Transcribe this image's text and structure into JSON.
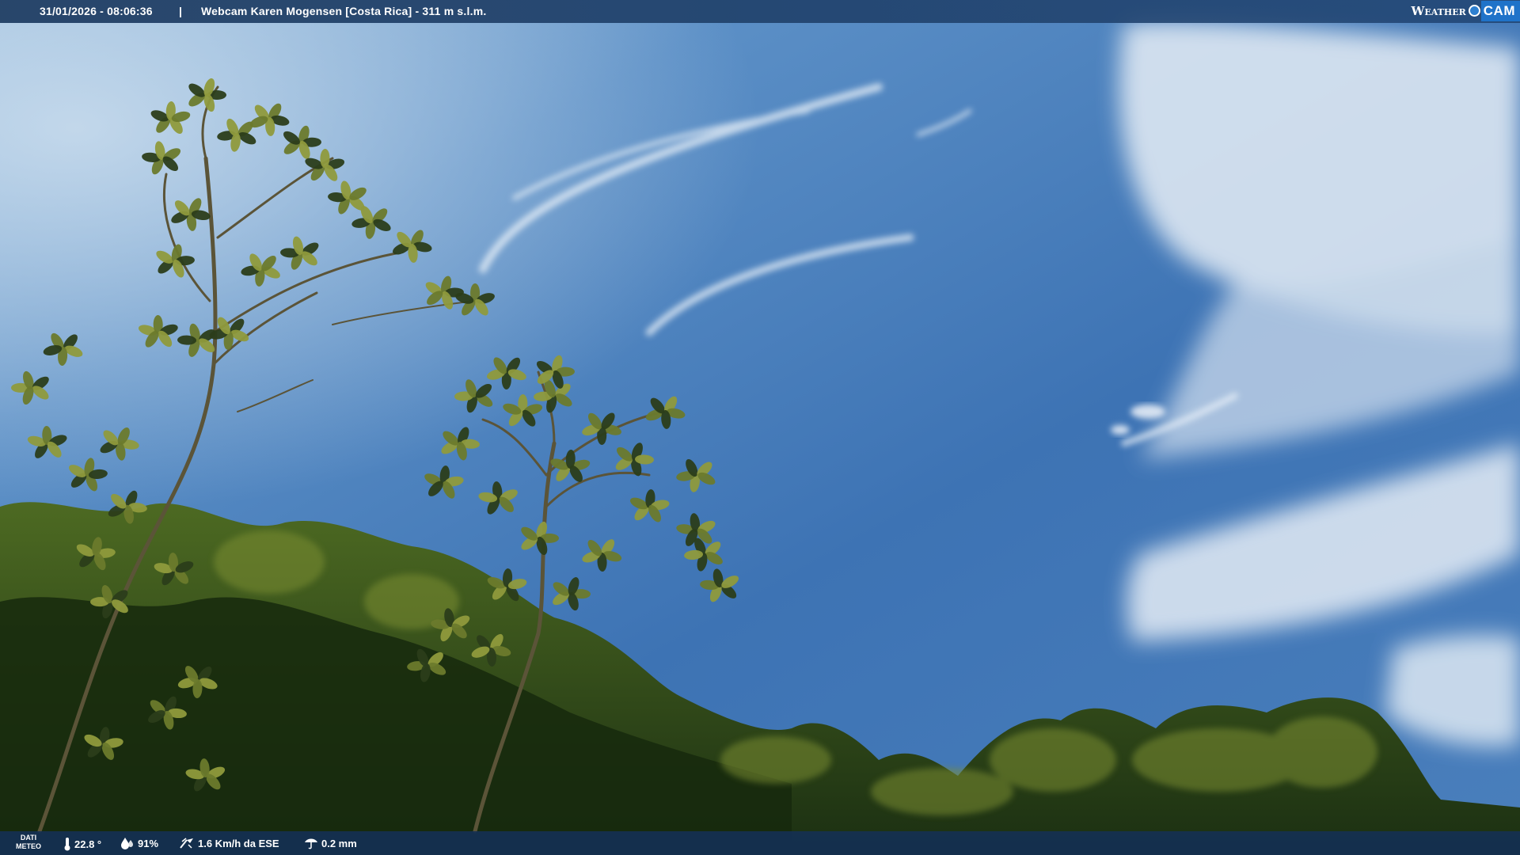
{
  "top_bar": {
    "datetime": "31/01/2026 - 08:06:36",
    "separator": "|",
    "title": "Webcam Karen Mogensen [Costa Rica]  - 311 m s.l.m.",
    "logo_weather": "Weather",
    "logo_cam": "CAM"
  },
  "bottom_bar": {
    "meteo_label_line1": "DATI",
    "meteo_label_line2": "METEO",
    "temperature": "22.8 °",
    "humidity": "91%",
    "wind": "1.6 Km/h da ESE",
    "rain": "0.2 mm",
    "icons": [
      "thermometer-icon",
      "humidity-drop-icon",
      "wind-icon",
      "rain-icon"
    ]
  },
  "colors": {
    "sky_top": "#3a6fb0",
    "sky_mid": "#4a7fbf",
    "sky_left_glow": "#a9c7e4",
    "foliage_dark": "#1f3614",
    "foliage_light": "#8d9c3a",
    "bar_bg": "#1c3a60",
    "logo_blue": "#1f73c9"
  }
}
